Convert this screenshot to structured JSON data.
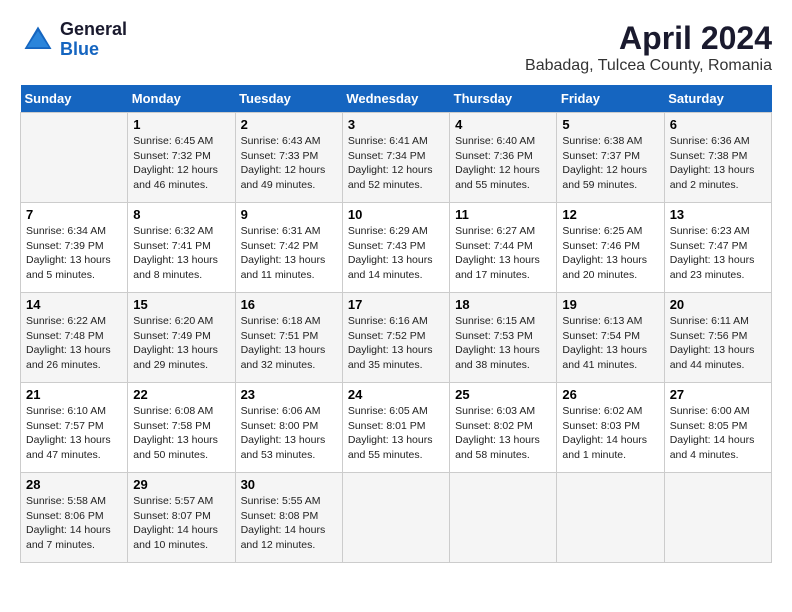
{
  "header": {
    "logo_line1": "General",
    "logo_line2": "Blue",
    "month_title": "April 2024",
    "location": "Babadag, Tulcea County, Romania"
  },
  "weekdays": [
    "Sunday",
    "Monday",
    "Tuesday",
    "Wednesday",
    "Thursday",
    "Friday",
    "Saturday"
  ],
  "weeks": [
    [
      {
        "day": "",
        "info": ""
      },
      {
        "day": "1",
        "info": "Sunrise: 6:45 AM\nSunset: 7:32 PM\nDaylight: 12 hours\nand 46 minutes."
      },
      {
        "day": "2",
        "info": "Sunrise: 6:43 AM\nSunset: 7:33 PM\nDaylight: 12 hours\nand 49 minutes."
      },
      {
        "day": "3",
        "info": "Sunrise: 6:41 AM\nSunset: 7:34 PM\nDaylight: 12 hours\nand 52 minutes."
      },
      {
        "day": "4",
        "info": "Sunrise: 6:40 AM\nSunset: 7:36 PM\nDaylight: 12 hours\nand 55 minutes."
      },
      {
        "day": "5",
        "info": "Sunrise: 6:38 AM\nSunset: 7:37 PM\nDaylight: 12 hours\nand 59 minutes."
      },
      {
        "day": "6",
        "info": "Sunrise: 6:36 AM\nSunset: 7:38 PM\nDaylight: 13 hours\nand 2 minutes."
      }
    ],
    [
      {
        "day": "7",
        "info": "Sunrise: 6:34 AM\nSunset: 7:39 PM\nDaylight: 13 hours\nand 5 minutes."
      },
      {
        "day": "8",
        "info": "Sunrise: 6:32 AM\nSunset: 7:41 PM\nDaylight: 13 hours\nand 8 minutes."
      },
      {
        "day": "9",
        "info": "Sunrise: 6:31 AM\nSunset: 7:42 PM\nDaylight: 13 hours\nand 11 minutes."
      },
      {
        "day": "10",
        "info": "Sunrise: 6:29 AM\nSunset: 7:43 PM\nDaylight: 13 hours\nand 14 minutes."
      },
      {
        "day": "11",
        "info": "Sunrise: 6:27 AM\nSunset: 7:44 PM\nDaylight: 13 hours\nand 17 minutes."
      },
      {
        "day": "12",
        "info": "Sunrise: 6:25 AM\nSunset: 7:46 PM\nDaylight: 13 hours\nand 20 minutes."
      },
      {
        "day": "13",
        "info": "Sunrise: 6:23 AM\nSunset: 7:47 PM\nDaylight: 13 hours\nand 23 minutes."
      }
    ],
    [
      {
        "day": "14",
        "info": "Sunrise: 6:22 AM\nSunset: 7:48 PM\nDaylight: 13 hours\nand 26 minutes."
      },
      {
        "day": "15",
        "info": "Sunrise: 6:20 AM\nSunset: 7:49 PM\nDaylight: 13 hours\nand 29 minutes."
      },
      {
        "day": "16",
        "info": "Sunrise: 6:18 AM\nSunset: 7:51 PM\nDaylight: 13 hours\nand 32 minutes."
      },
      {
        "day": "17",
        "info": "Sunrise: 6:16 AM\nSunset: 7:52 PM\nDaylight: 13 hours\nand 35 minutes."
      },
      {
        "day": "18",
        "info": "Sunrise: 6:15 AM\nSunset: 7:53 PM\nDaylight: 13 hours\nand 38 minutes."
      },
      {
        "day": "19",
        "info": "Sunrise: 6:13 AM\nSunset: 7:54 PM\nDaylight: 13 hours\nand 41 minutes."
      },
      {
        "day": "20",
        "info": "Sunrise: 6:11 AM\nSunset: 7:56 PM\nDaylight: 13 hours\nand 44 minutes."
      }
    ],
    [
      {
        "day": "21",
        "info": "Sunrise: 6:10 AM\nSunset: 7:57 PM\nDaylight: 13 hours\nand 47 minutes."
      },
      {
        "day": "22",
        "info": "Sunrise: 6:08 AM\nSunset: 7:58 PM\nDaylight: 13 hours\nand 50 minutes."
      },
      {
        "day": "23",
        "info": "Sunrise: 6:06 AM\nSunset: 8:00 PM\nDaylight: 13 hours\nand 53 minutes."
      },
      {
        "day": "24",
        "info": "Sunrise: 6:05 AM\nSunset: 8:01 PM\nDaylight: 13 hours\nand 55 minutes."
      },
      {
        "day": "25",
        "info": "Sunrise: 6:03 AM\nSunset: 8:02 PM\nDaylight: 13 hours\nand 58 minutes."
      },
      {
        "day": "26",
        "info": "Sunrise: 6:02 AM\nSunset: 8:03 PM\nDaylight: 14 hours\nand 1 minute."
      },
      {
        "day": "27",
        "info": "Sunrise: 6:00 AM\nSunset: 8:05 PM\nDaylight: 14 hours\nand 4 minutes."
      }
    ],
    [
      {
        "day": "28",
        "info": "Sunrise: 5:58 AM\nSunset: 8:06 PM\nDaylight: 14 hours\nand 7 minutes."
      },
      {
        "day": "29",
        "info": "Sunrise: 5:57 AM\nSunset: 8:07 PM\nDaylight: 14 hours\nand 10 minutes."
      },
      {
        "day": "30",
        "info": "Sunrise: 5:55 AM\nSunset: 8:08 PM\nDaylight: 14 hours\nand 12 minutes."
      },
      {
        "day": "",
        "info": ""
      },
      {
        "day": "",
        "info": ""
      },
      {
        "day": "",
        "info": ""
      },
      {
        "day": "",
        "info": ""
      }
    ]
  ]
}
